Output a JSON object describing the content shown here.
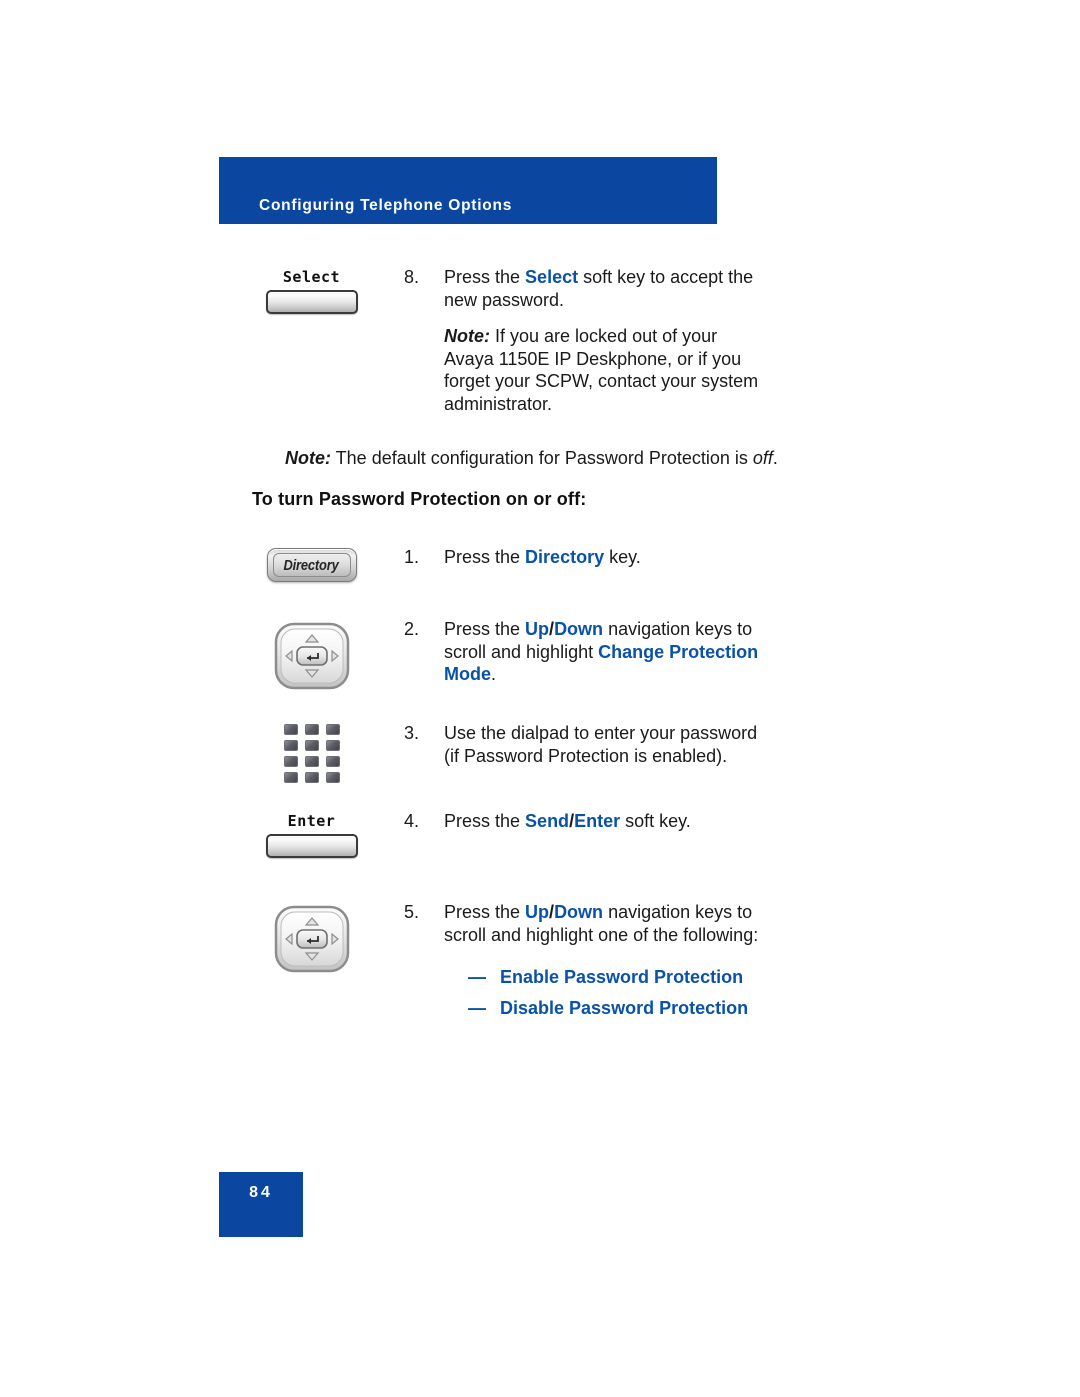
{
  "header": {
    "title": "Configuring Telephone Options",
    "banner_color": "#0b47a0"
  },
  "colors": {
    "banner_blue": "#0b47a0",
    "emphasis_blue": "#0a52a8",
    "body_text": "#1a1a1a"
  },
  "steps": [
    {
      "number": "8.",
      "icon": "select-softkey",
      "icon_label": "Select",
      "lines": [
        {
          "segments": [
            {
              "text": "Press the ",
              "style": "normal"
            },
            {
              "text": "Select",
              "style": "blue-bold"
            },
            {
              "text": " soft key to accept the new password.",
              "style": "normal"
            }
          ]
        },
        {
          "spaced": true,
          "segments": [
            {
              "text": "Note:",
              "style": "bold-italic"
            },
            {
              "text": " If you are locked out of your Avaya 1150E IP Deskphone, or if you forget your SCPW, contact your system administrator.",
              "style": "normal"
            }
          ]
        }
      ]
    },
    {
      "number": "1.",
      "icon": "directory-key",
      "icon_label": "Directory",
      "lines": [
        {
          "segments": [
            {
              "text": "Press the ",
              "style": "normal"
            },
            {
              "text": "Directory",
              "style": "blue-bold"
            },
            {
              "text": " key.",
              "style": "normal"
            }
          ]
        }
      ]
    },
    {
      "number": "2.",
      "icon": "navigation-keys",
      "icon_label": "",
      "lines": [
        {
          "segments": [
            {
              "text": "Press the ",
              "style": "normal"
            },
            {
              "text": "Up",
              "style": "blue-bold"
            },
            {
              "text": "/",
              "style": "bold"
            },
            {
              "text": "Down",
              "style": "blue-bold"
            },
            {
              "text": " navigation keys to scroll and highlight ",
              "style": "normal"
            },
            {
              "text": "Change Protection Mode",
              "style": "blue-bold"
            },
            {
              "text": ".",
              "style": "normal"
            }
          ]
        }
      ]
    },
    {
      "number": "3.",
      "icon": "dialpad",
      "icon_label": "",
      "lines": [
        {
          "segments": [
            {
              "text": "Use the dialpad to enter your password (if Password Protection is enabled).",
              "style": "normal"
            }
          ]
        }
      ]
    },
    {
      "number": "4.",
      "icon": "enter-softkey",
      "icon_label": "Enter",
      "lines": [
        {
          "segments": [
            {
              "text": "Press the ",
              "style": "normal"
            },
            {
              "text": "Send",
              "style": "blue-bold"
            },
            {
              "text": "/",
              "style": "bold"
            },
            {
              "text": "Enter",
              "style": "blue-bold"
            },
            {
              "text": " soft key.",
              "style": "normal"
            }
          ]
        }
      ]
    },
    {
      "number": "5.",
      "icon": "navigation-keys",
      "icon_label": "",
      "lines": [
        {
          "segments": [
            {
              "text": "Press the ",
              "style": "normal"
            },
            {
              "text": "Up",
              "style": "blue-bold"
            },
            {
              "text": "/",
              "style": "bold"
            },
            {
              "text": "Down",
              "style": "blue-bold"
            },
            {
              "text": " navigation keys to scroll and highlight one of the following:",
              "style": "normal"
            }
          ]
        }
      ],
      "bullets": [
        {
          "dash": "—",
          "text": "Enable Password Protection"
        },
        {
          "dash": "—",
          "text": "Disable Password Protection"
        }
      ]
    }
  ],
  "standalone_note": {
    "label": "Note:",
    "text_before": " The default configuration for Password Protection is ",
    "italic_tail": "off",
    "text_after": "."
  },
  "section_heading": "To turn Password Protection on or off:",
  "footer": {
    "page_number": "84"
  }
}
